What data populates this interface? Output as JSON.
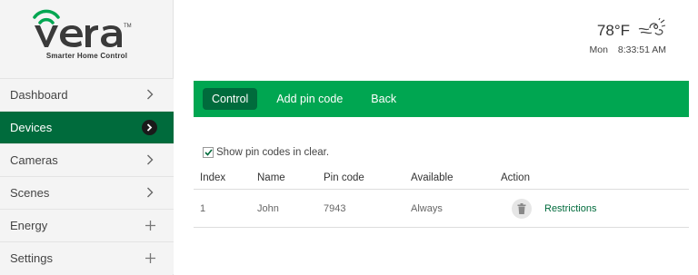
{
  "brand": {
    "name": "vera",
    "tagline": "Smarter Home Control"
  },
  "colors": {
    "primary_green": "#00a651",
    "dark_green": "#006b3c"
  },
  "sidebar": {
    "items": [
      {
        "label": "Dashboard",
        "icon": "chevron-right-icon"
      },
      {
        "label": "Devices",
        "icon": "chevron-right-circle-icon",
        "active": true
      },
      {
        "label": "Cameras",
        "icon": "chevron-right-icon"
      },
      {
        "label": "Scenes",
        "icon": "chevron-right-icon"
      },
      {
        "label": "Energy",
        "icon": "plus-icon"
      },
      {
        "label": "Settings",
        "icon": "plus-icon"
      }
    ]
  },
  "header": {
    "temperature": "78°F",
    "weather_icon": "windy-weather-icon",
    "day": "Mon",
    "time": "8:33:51 AM"
  },
  "toolbar": {
    "control_label": "Control",
    "add_pin_label": "Add pin code",
    "back_label": "Back"
  },
  "options": {
    "show_pin_label": "Show pin codes in clear.",
    "show_pin_checked": true
  },
  "table": {
    "headers": [
      "Index",
      "Name",
      "Pin code",
      "Available",
      "Action"
    ],
    "rows": [
      {
        "index": "1",
        "name": "John",
        "pin": "7943",
        "available": "Always",
        "action_label": "Restrictions"
      }
    ]
  }
}
